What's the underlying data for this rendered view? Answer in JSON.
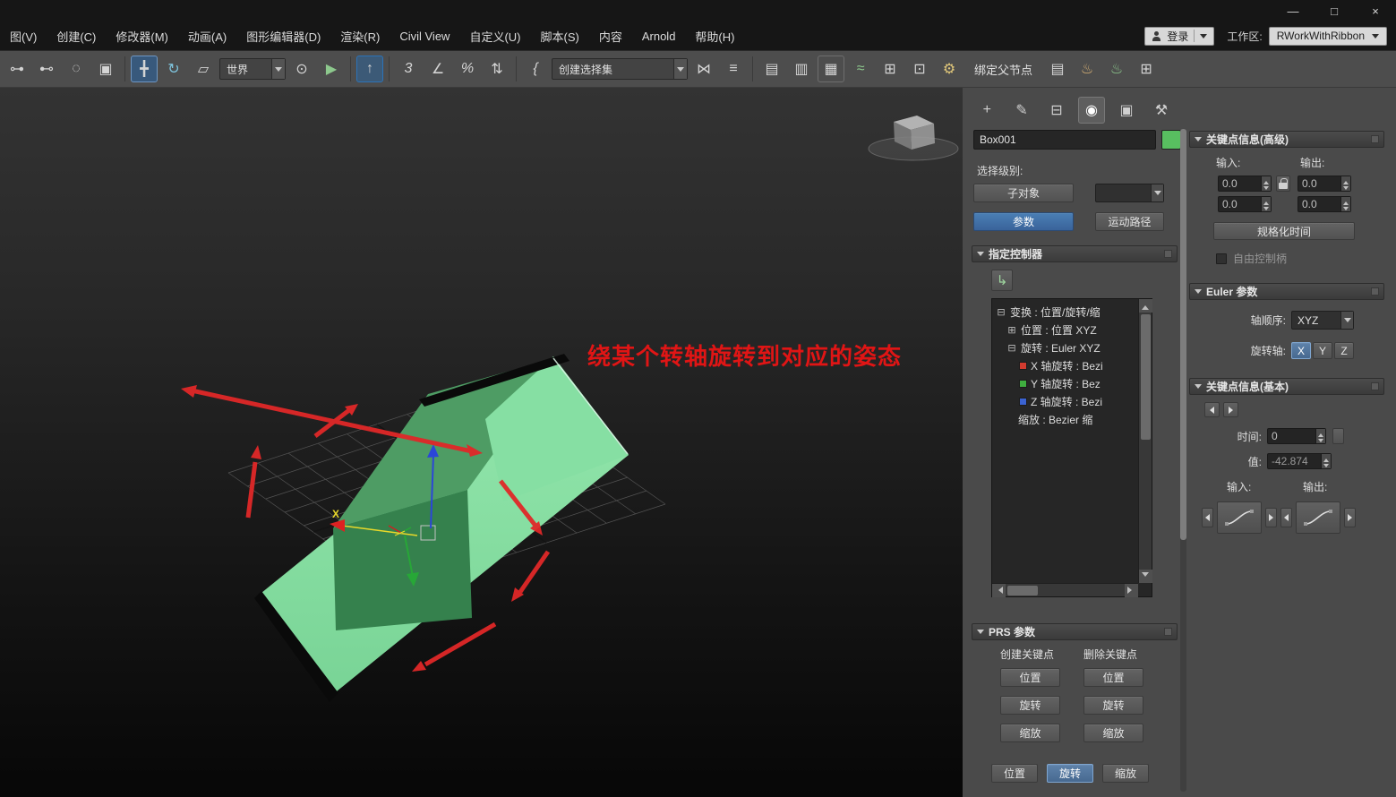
{
  "colors": {
    "accent_blue": "#3d6fa8",
    "object_color": "#58bf60",
    "plane_green": "#8ae0a6",
    "box_green": "#37824e",
    "annotation_red": "#e01515",
    "axis_x_color": "#e8d82a",
    "axis_y_color": "#27a737",
    "axis_z_color": "#2b46d8"
  },
  "window": {
    "minimize": "—",
    "maximize": "□",
    "close": "×"
  },
  "menu": {
    "items": [
      "图(V)",
      "创建(C)",
      "修改器(M)",
      "动画(A)",
      "图形编辑器(D)",
      "渲染(R)",
      "Civil View",
      "自定义(U)",
      "脚本(S)",
      "内容",
      "Arnold",
      "帮助(H)"
    ],
    "login_label": "登录",
    "workspace_label": "工作区:",
    "workspace_value": "RWorkWithRibbon"
  },
  "toolbar": {
    "coord_system_value": "世界",
    "selection_set_value": "创建选择集",
    "bind_parent_label": "绑定父节点"
  },
  "icons": {
    "link": "⊶",
    "unlink": "⊷",
    "region": "◌",
    "window_crossing": "▣",
    "move": "╋",
    "rotate": "↻",
    "scale": "▱",
    "pivot": "⊙",
    "manipulate": "▶",
    "kbd_override": "↑",
    "snap_toggle": "3",
    "angle_snap": "∠",
    "percent_snap": "%",
    "spinner_snap": "⇅",
    "named_sets": "{",
    "mirror": "⋈",
    "align": "≡",
    "scene_explorer": "▤",
    "layer_explorer": "▥",
    "ribbon": "▦",
    "curve_editor": "≈",
    "dope_sheet": "⊞",
    "schematic_view": "⊡",
    "container": "⚙",
    "clipboard": "▤",
    "place_tool": "♨",
    "render_frame": "♨",
    "quad_grid": "⊞",
    "tab_create": "+",
    "tab_modify": "✎",
    "tab_hierarchy": "⊟",
    "tab_motion": "◉",
    "tab_display": "▣",
    "tab_utilities": "⚒",
    "expander_open": "⊟",
    "expander_closed": "⊞",
    "assign_controller": "↳"
  },
  "viewport": {
    "annotation": "绕某个转轴旋转到对应的姿态",
    "gizmo_axis_label": "X"
  },
  "command_panel": {
    "object_name": "Box001",
    "selection_level_label": "选择级别:",
    "sub_object_label": "子对象",
    "parameters_label": "参数",
    "motion_paths_label": "运动路径",
    "assign_controller": {
      "title": "指定控制器",
      "tree": [
        {
          "label": "变换 : 位置/旋转/缩"
        },
        {
          "label": "位置 : 位置 XYZ"
        },
        {
          "label": "旋转 : Euler XYZ"
        },
        {
          "label": "X 轴旋转 : Bezi"
        },
        {
          "label": "Y 轴旋转 : Bez"
        },
        {
          "label": "Z 轴旋转 : Bezi"
        },
        {
          "label": "缩放 : Bezier 缩"
        }
      ]
    },
    "prs": {
      "title": "PRS 参数",
      "create_keys_label": "创建关键点",
      "delete_keys_label": "删除关键点",
      "create_position": "位置",
      "create_rotation": "旋转",
      "create_scale": "缩放",
      "delete_position": "位置",
      "delete_rotation": "旋转",
      "delete_scale": "缩放",
      "bottom_position": "位置",
      "bottom_rotation": "旋转",
      "bottom_scale": "缩放"
    },
    "key_info_advanced": {
      "title": "关键点信息(高级)",
      "in_label": "输入:",
      "out_label": "输出:",
      "in1": "0.0",
      "out1": "0.0",
      "in2": "0.0",
      "out2": "0.0",
      "normalize_time_label": "规格化时间",
      "free_handle_label": "自由控制柄"
    },
    "euler": {
      "title": "Euler 参数",
      "axis_order_label": "轴顺序:",
      "axis_order_value": "XYZ",
      "rotation_axis_label": "旋转轴:",
      "axis_x": "X",
      "axis_y": "Y",
      "axis_z": "Z"
    },
    "key_info_basic": {
      "title": "关键点信息(基本)",
      "time_label": "时间:",
      "time_value": "0",
      "value_label": "值:",
      "value_value": "-42.874",
      "in_label": "输入:",
      "out_label": "输出:"
    }
  }
}
